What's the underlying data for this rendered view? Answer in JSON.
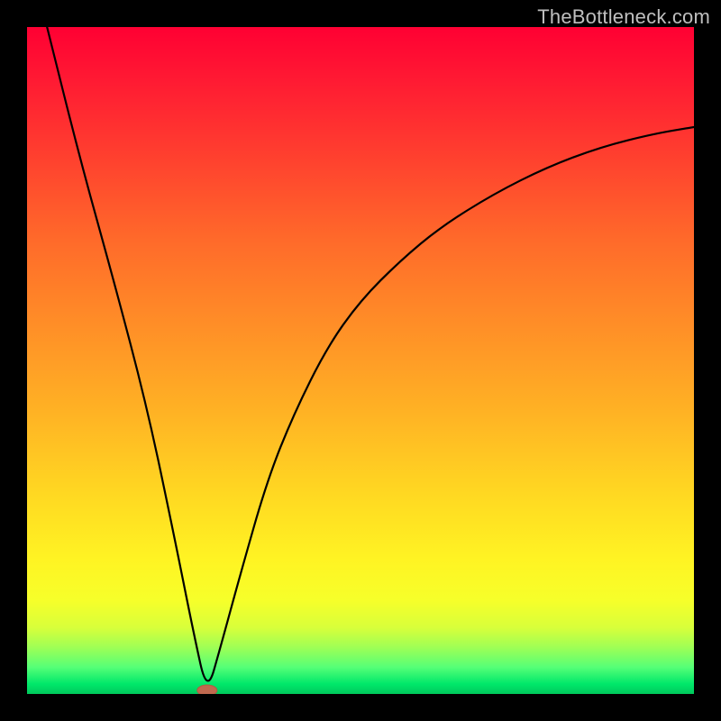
{
  "watermark": "TheBottleneck.com",
  "chart_data": {
    "type": "line",
    "title": "",
    "xlabel": "",
    "ylabel": "",
    "xlim": [
      0,
      100
    ],
    "ylim": [
      0,
      100
    ],
    "grid": false,
    "legend": false,
    "description": "V-shaped bottleneck curve over a vertical red→yellow→green gradient; minimum near x≈27 at y≈0; right branch rises asymptotically toward ~85.",
    "series": [
      {
        "name": "bottleneck-curve",
        "x": [
          3,
          8,
          13,
          18,
          22,
          25,
          27,
          29,
          32,
          36,
          40,
          45,
          50,
          56,
          62,
          70,
          78,
          86,
          94,
          100
        ],
        "values": [
          100,
          80,
          62,
          43,
          24,
          9,
          0,
          7,
          18,
          32,
          42,
          52,
          59,
          65,
          70,
          75,
          79,
          82,
          84,
          85
        ]
      }
    ],
    "minimum_marker": {
      "x": 27,
      "y": 0
    },
    "gradient_stops": [
      {
        "pct": 0,
        "color": "#ff0033"
      },
      {
        "pct": 18,
        "color": "#ff3b2f"
      },
      {
        "pct": 45,
        "color": "#ff8f27"
      },
      {
        "pct": 70,
        "color": "#ffd822"
      },
      {
        "pct": 86,
        "color": "#f6ff2a"
      },
      {
        "pct": 96,
        "color": "#55ff77"
      },
      {
        "pct": 100,
        "color": "#00c85c"
      }
    ]
  }
}
